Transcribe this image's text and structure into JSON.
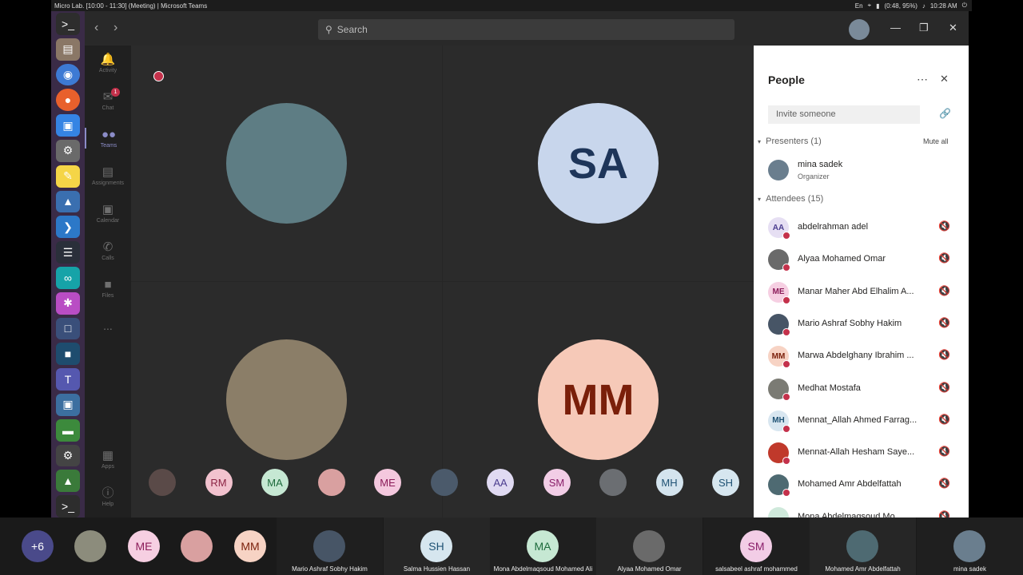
{
  "window": {
    "title": "Micro Lab. [10:00 - 11:30] (Meeting) | Microsoft Teams",
    "clock": "10:28 AM",
    "battery": "(0:48, 95%)",
    "lang": "En"
  },
  "search": {
    "placeholder": "Search"
  },
  "rail": [
    {
      "label": "Activity"
    },
    {
      "label": "Chat",
      "badge": "1"
    },
    {
      "label": "Teams"
    },
    {
      "label": "Assignments"
    },
    {
      "label": "Calendar"
    },
    {
      "label": "Calls"
    },
    {
      "label": "Files"
    },
    {
      "label": "..."
    },
    {
      "label": "Apps"
    },
    {
      "label": "Help"
    }
  ],
  "stage": {
    "tiles": [
      {
        "initials": "",
        "bg": "#5e7d84",
        "fg": "#1e3559"
      },
      {
        "initials": "SA",
        "bg": "#c8d6ec",
        "fg": "#1e3559"
      },
      {
        "initials": "",
        "bg": "#8b7e68",
        "fg": "#1e3559"
      },
      {
        "initials": "MM",
        "bg": "#f6c9b8",
        "fg": "#7a1f0a"
      }
    ],
    "strip": [
      {
        "t": "",
        "bg": "#5a4a48",
        "fg": "#fff"
      },
      {
        "t": "RM",
        "bg": "#f2c2ce",
        "fg": "#8c2444"
      },
      {
        "t": "MA",
        "bg": "#c6e8d3",
        "fg": "#1d6b3c"
      },
      {
        "t": "",
        "bg": "#d9a0a0",
        "fg": "#fff"
      },
      {
        "t": "ME",
        "bg": "#f4c8de",
        "fg": "#8c1d5a"
      },
      {
        "t": "",
        "bg": "#4b5a6b",
        "fg": "#fff"
      },
      {
        "t": "AA",
        "bg": "#e0daf2",
        "fg": "#4b3d8f"
      },
      {
        "t": "SM",
        "bg": "#f2cde6",
        "fg": "#8a1f6a"
      },
      {
        "t": "",
        "bg": "#6b6e72",
        "fg": "#fff"
      },
      {
        "t": "MH",
        "bg": "#d4e4ee",
        "fg": "#205375"
      },
      {
        "t": "SH",
        "bg": "#d6e6ef",
        "fg": "#205375"
      }
    ]
  },
  "people": {
    "title": "People",
    "invite_placeholder": "Invite someone",
    "presenters_label": "Presenters (1)",
    "mute_all": "Mute all",
    "attendees_label": "Attendees (15)",
    "organizer": {
      "name": "mina sadek",
      "role": "Organizer"
    },
    "attendees": [
      {
        "name": "abdelrahman adel",
        "initials": "AA",
        "bg": "#e6dff3",
        "fg": "#4b3d8f"
      },
      {
        "name": "Alyaa Mohamed Omar",
        "initials": "",
        "bg": "#6a6a6a",
        "fg": "#fff"
      },
      {
        "name": "Manar Maher Abd Elhalim A...",
        "initials": "ME",
        "bg": "#f6cfe2",
        "fg": "#8c1d5a"
      },
      {
        "name": "Mario Ashraf Sobhy Hakim",
        "initials": "",
        "bg": "#475566",
        "fg": "#fff"
      },
      {
        "name": "Marwa Abdelghany Ibrahim ...",
        "initials": "MM",
        "bg": "#f7d3c4",
        "fg": "#7a1f0a"
      },
      {
        "name": "Medhat Mostafa",
        "initials": "",
        "bg": "#7b7b74",
        "fg": "#fff"
      },
      {
        "name": "Mennat_Allah Ahmed Farrag...",
        "initials": "MH",
        "bg": "#d8e6f0",
        "fg": "#205375"
      },
      {
        "name": "Mennat-Allah Hesham Saye...",
        "initials": "",
        "bg": "#c0392b",
        "fg": "#fff"
      },
      {
        "name": "Mohamed Amr Abdelfattah",
        "initials": "",
        "bg": "#4e6a72",
        "fg": "#fff"
      },
      {
        "name": "Mona Abdelmaqsoud Mo...",
        "initials": "",
        "bg": "#cfe9db",
        "fg": "#1d6b3c"
      }
    ]
  },
  "bottom": {
    "tiles": [
      {
        "initials": "+6",
        "name": "",
        "bg": "#4a4a8a",
        "fg": "#fff"
      },
      {
        "initials": "",
        "name": "",
        "bg": "#8c8c7c",
        "fg": "#fff"
      },
      {
        "initials": "ME",
        "name": "",
        "bg": "#f6cfe2",
        "fg": "#8c1d5a"
      },
      {
        "initials": "",
        "name": "",
        "bg": "#d9a0a0",
        "fg": "#fff"
      },
      {
        "initials": "MM",
        "name": "",
        "bg": "#f7d3c4",
        "fg": "#7a1f0a"
      },
      {
        "initials": "",
        "name": "Mario Ashraf Sobhy Hakim",
        "bg": "#475566",
        "fg": "#fff"
      },
      {
        "initials": "SH",
        "name": "Salma Hussien Hassan",
        "bg": "#d6e6ef",
        "fg": "#205375"
      },
      {
        "initials": "MA",
        "name": "Mona Abdelmaqsoud Mohamed Ali",
        "bg": "#c6e8d3",
        "fg": "#1d6b3c"
      },
      {
        "initials": "",
        "name": "Alyaa Mohamed Omar",
        "bg": "#6a6a6a",
        "fg": "#fff"
      },
      {
        "initials": "SM",
        "name": "salsabeel ashraf mohammed",
        "bg": "#f2cde6",
        "fg": "#8a1f6a"
      },
      {
        "initials": "",
        "name": "Mohamed Amr Abdelfattah",
        "bg": "#4e6a72",
        "fg": "#fff"
      },
      {
        "initials": "",
        "name": "mina sadek",
        "bg": "#6a7e8e",
        "fg": "#fff"
      }
    ]
  }
}
